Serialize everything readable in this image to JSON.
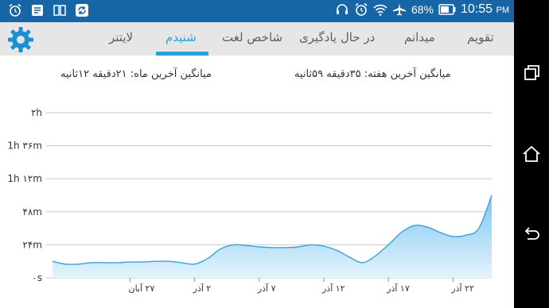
{
  "status_bar": {
    "battery": "68%",
    "time": "10:55",
    "time_suffix": "PM",
    "background": "#1565a7"
  },
  "tabs": [
    {
      "label": "تقویم",
      "active": false
    },
    {
      "label": "میدانم",
      "active": false
    },
    {
      "label": "در حال یادگیری",
      "active": false
    },
    {
      "label": "شاخص لغت",
      "active": false
    },
    {
      "label": "شنیدم",
      "active": true
    },
    {
      "label": "لایتنر",
      "active": false
    }
  ],
  "stats": {
    "week_average": "میانگین آخرین هفته: ۳۵دقیقه  ۵۹ثانیه",
    "month_average": "میانگین آخرین ماه: ۲۱دقیقه  ۱۲ثانیه"
  },
  "colors": {
    "accent": "#29a2d8",
    "tab_bar": "#e6e6e6",
    "area_fill_top": "#7cc7f1",
    "area_fill_bottom": "#e4f4fd",
    "line": "#3a9fe0"
  },
  "chart_data": {
    "type": "area",
    "y_unit": "minutes",
    "ylim": [
      0,
      120
    ],
    "y_ticks": [
      {
        "value": 0,
        "label": "۰s"
      },
      {
        "value": 24,
        "label": "۲۴m"
      },
      {
        "value": 48,
        "label": "۴۸m"
      },
      {
        "value": 72,
        "label": "1h ۱۲m"
      },
      {
        "value": 96,
        "label": "1h ۳۶m"
      },
      {
        "value": 120,
        "label": "۲h"
      }
    ],
    "x_ticks": [
      {
        "day": 0,
        "label": "۲۷ آبان"
      },
      {
        "day": 5,
        "label": "۲ آذر"
      },
      {
        "day": 10,
        "label": "۷ آذر"
      },
      {
        "day": 15,
        "label": "۱۲ آذر"
      },
      {
        "day": 20,
        "label": "۱۷ آذر"
      },
      {
        "day": 25,
        "label": "۲۲ آذر"
      }
    ],
    "grid": true,
    "series": [
      {
        "points": [
          [
            -6,
            12
          ],
          [
            -5,
            10
          ],
          [
            -4,
            10
          ],
          [
            -3,
            11
          ],
          [
            -2,
            11
          ],
          [
            -1,
            11
          ],
          [
            0,
            11.5
          ],
          [
            1,
            11.5
          ],
          [
            2,
            12
          ],
          [
            3,
            12
          ],
          [
            4,
            11
          ],
          [
            5,
            10
          ],
          [
            6,
            14
          ],
          [
            7,
            21
          ],
          [
            8,
            24
          ],
          [
            9,
            23.5
          ],
          [
            10,
            22.5
          ],
          [
            11,
            22
          ],
          [
            12,
            22
          ],
          [
            13,
            22.5
          ],
          [
            14,
            24
          ],
          [
            15,
            23
          ],
          [
            16,
            20
          ],
          [
            17,
            15
          ],
          [
            18,
            11
          ],
          [
            19,
            16
          ],
          [
            20,
            24
          ],
          [
            21,
            33
          ],
          [
            22,
            38
          ],
          [
            23,
            37
          ],
          [
            24,
            33
          ],
          [
            25,
            30
          ],
          [
            26,
            31
          ],
          [
            27,
            36
          ],
          [
            28,
            60
          ]
        ]
      }
    ]
  }
}
